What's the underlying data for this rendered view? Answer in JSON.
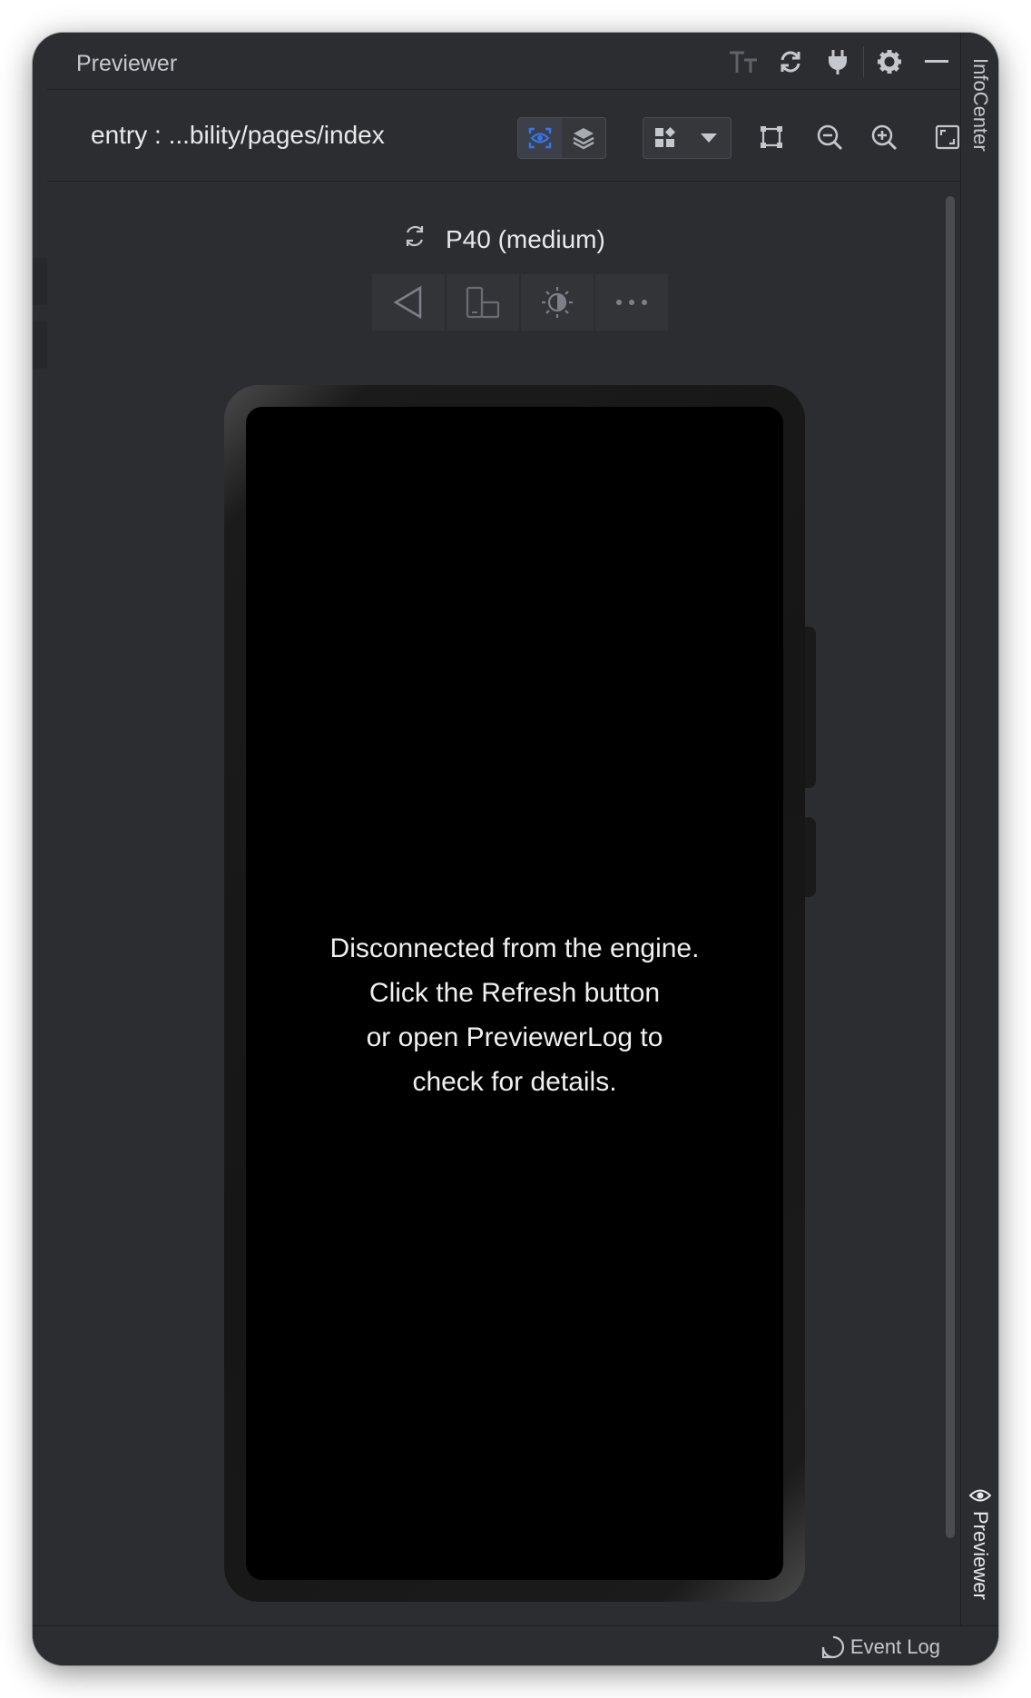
{
  "window": {
    "title": "Previewer"
  },
  "toolbar": {
    "path": "entry : ...bility/pages/index"
  },
  "device": {
    "name": "P40 (medium)"
  },
  "screen": {
    "message_lines": [
      "Disconnected from the engine.",
      "Click the Refresh button",
      "or open PreviewerLog to",
      "check for details."
    ]
  },
  "side_tabs": {
    "infocenter": "InfoCenter",
    "previewer": "Previewer"
  },
  "status_bar": {
    "event_log": "Event Log"
  },
  "colors": {
    "accent": "#3574f0",
    "panel_bg": "#2b2d30",
    "screen_bg": "#000000"
  },
  "icons": {
    "title_bar": [
      "font-size-icon",
      "refresh-icon",
      "plug-icon",
      "gear-icon",
      "minimize-icon"
    ],
    "toolbar": [
      "inspector-icon",
      "layers-icon",
      "components-icon",
      "chevron-down-icon",
      "crop-icon",
      "zoom-out-icon",
      "zoom-in-icon",
      "fit-screen-icon"
    ],
    "device_controls": [
      "back-icon",
      "rotate-device-icon",
      "theme-icon",
      "more-icon"
    ]
  }
}
